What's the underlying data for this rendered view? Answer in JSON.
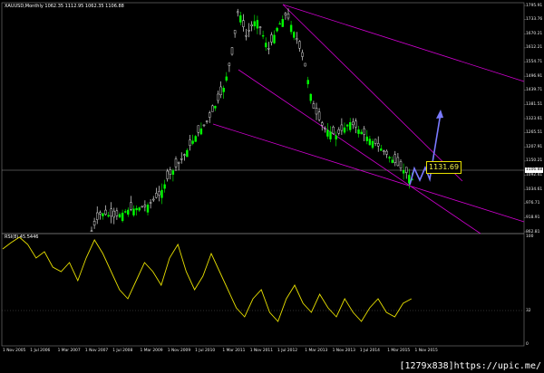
{
  "symbol_header": "XAUUSD,Monthly  1062.35 1112.95 1062.35 1106.88",
  "rsi_header": "RSI(8) 45.5446",
  "price_axis": [
    "1795.91",
    "1733.76",
    "1670.21",
    "1612.21",
    "1554.71",
    "1496.91",
    "1439.71",
    "1381.51",
    "1323.61",
    "1265.51",
    "1207.91",
    "1150.21",
    "1092.41",
    "1034.61",
    "976.71",
    "918.91",
    "862.81"
  ],
  "current_price": "1106.88",
  "target_tag": "1131.69",
  "rsi_axis": [
    "100",
    "32",
    "0"
  ],
  "time_axis": [
    "1 Nov 2005",
    "1 Jul 2006",
    "1 Mar 2007",
    "1 Nov 2007",
    "1 Jul 2008",
    "1 Mar 2009",
    "1 Nov 2009",
    "1 Jul 2010",
    "1 Mar 2011",
    "1 Nov 2011",
    "1 Jul 2012",
    "1 Mar 2013",
    "1 Nov 2013",
    "1 Jul 2014",
    "1 Mar 2015",
    "1 Nov 2015"
  ],
  "watermark": "[1279x838]https://upic.me/",
  "colors": {
    "bull": "#00ff00",
    "bear": "#ffffff",
    "channel": "#ff00ff",
    "rsi": "#ffff00",
    "arrow": "#7070ff"
  }
}
